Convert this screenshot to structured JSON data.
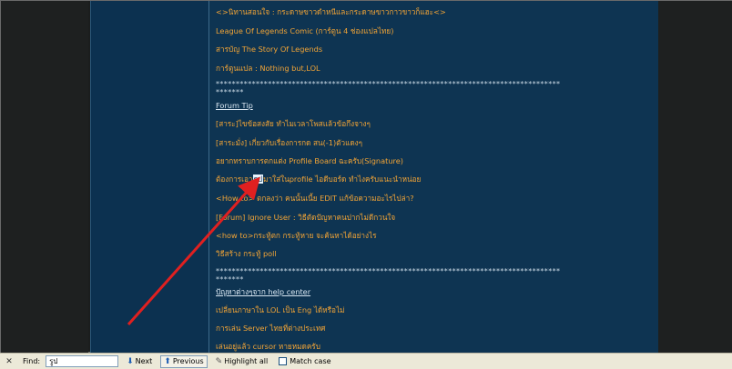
{
  "forum": {
    "lines_top": [
      "<>นิทานสอนใจ : กระดาษขาวดำหนีและกระดาษขาวกาวขาวก็แฮะ<>",
      "League Of Legends Comic (การ์ตูน 4 ช่องแปลไทย)",
      "สารบัญ The Story Of Legends",
      "การ์ตูนแปล : Nothing but,LOL"
    ],
    "stars_1a": "**************************************************************************************",
    "stars_1b": "*******",
    "section1_title": "Forum Tip",
    "section1_items": [
      "[สาระ]ไขข้อสงสัย ทำไมเวลาโพสแล้วข้อกึงจางๆ",
      "[สาระมั่ง] เกี่ยวกับเรื่องการกด สน(-1)ตัวแดงๆ",
      "อยากทราบการตกแต่ง Profile Board ฉะครับ(Signature)",
      "ต้องการเอา",
      "<How to> ตกลงว่า คนนั้นเนี้ย EDIT แก้ข้อความอะไรไปล่า?",
      "[Forum] Ignore User : วิธีตัดปัญหาคนปากไม่ดีกวนใจ",
      "<how to>กระทู้ตก กระทู้หาย จะค้นหาได้อย่างไร",
      "วิธีสร้าง กระทู้ poll"
    ],
    "highlight_before": "ต้องการเอา",
    "highlight_word": "รูป",
    "highlight_after": "มาใส่ในprofile ไอดีบอร์ด ทำไงครับแนะนำหน่อย",
    "stars_2a": "**************************************************************************************",
    "stars_2b": "*******",
    "section2_title": "ปัญหาต่างๆจาก help center",
    "section2_items": [
      "เปลี่ยนภาษาใน LOL เป็น Eng ได้หรือไม่",
      "การเล่น Server ไทยที่ต่างประเทศ",
      "เล่นอยู่แล้ว cursor หายหมดครับ"
    ]
  },
  "findbar": {
    "close_icon": "close-icon",
    "find_label": "Find:",
    "find_value": "รูป",
    "next_label": "Next",
    "previous_label": "Previous",
    "highlight_label": "Highlight all",
    "match_case_label": "Match case"
  },
  "colors": {
    "page_bg": "#0d3350",
    "link_orange": "#f2a436",
    "arrow_red": "#e02020"
  }
}
